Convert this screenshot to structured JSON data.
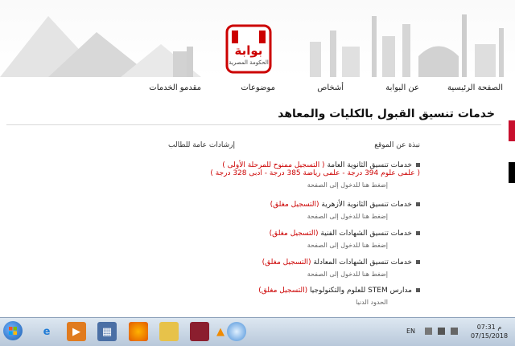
{
  "logo": {
    "word": "بوابة",
    "sub": "الحكومة المصرية"
  },
  "nav": {
    "home": "الصفحة الرئيسية",
    "about": "عن البوابة",
    "people": "أشخاص",
    "topics": "موضوعات",
    "providers": "مقدمو الخدمات"
  },
  "page": {
    "title": "خدمات تنسيق القبول بالكليات والمعاهد"
  },
  "sidebar": {
    "about_site": "نبذة عن الموقع",
    "student_guide": "إرشادات عامة للطالب"
  },
  "services": [
    {
      "name": "خدمات تنسيق الثانوية العامة",
      "status": "( التسجيل ممنوح للمرحلة الأولى )",
      "detail": "( علمى علوم 394 درجة - علمى رياضة 385 درجة - ادبى 328 درجة )",
      "link": "إضغط هنا للدخول إلى الصفحة"
    },
    {
      "name": "خدمات تنسيق الثانوية الأزهرية",
      "status": "(التسجيل مغلق)",
      "link": "إضغط هنا للدخول إلى الصفحة"
    },
    {
      "name": "خدمات تنسيق الشهادات الفنية",
      "status": "(التسجيل مغلق)",
      "link": "إضغط هنا للدخول إلى الصفحة"
    },
    {
      "name": "خدمات تنسيق الشهادات المعادلة",
      "status": "(التسجيل مغلق)",
      "link": "إضغط هنا للدخول إلى الصفحة"
    },
    {
      "name": "مدارس STEM للعلوم والتكنولوجيا",
      "status": "(التسجيل مغلق)",
      "link": "الحدود الدنيا"
    }
  ],
  "taskbar": {
    "lang": "EN",
    "time": "م 07:31",
    "date": "07/15/2018",
    "icons": [
      "windows-start-icon",
      "internet-explorer-icon",
      "media-player-icon",
      "folder-icon",
      "firefox-icon",
      "archive-icon",
      "vlc-icon",
      "settings-icon",
      "browser-icon"
    ]
  },
  "colors": {
    "accent_red": "#cc0000",
    "flag_red": "#c8102e",
    "flag_black": "#000000"
  }
}
